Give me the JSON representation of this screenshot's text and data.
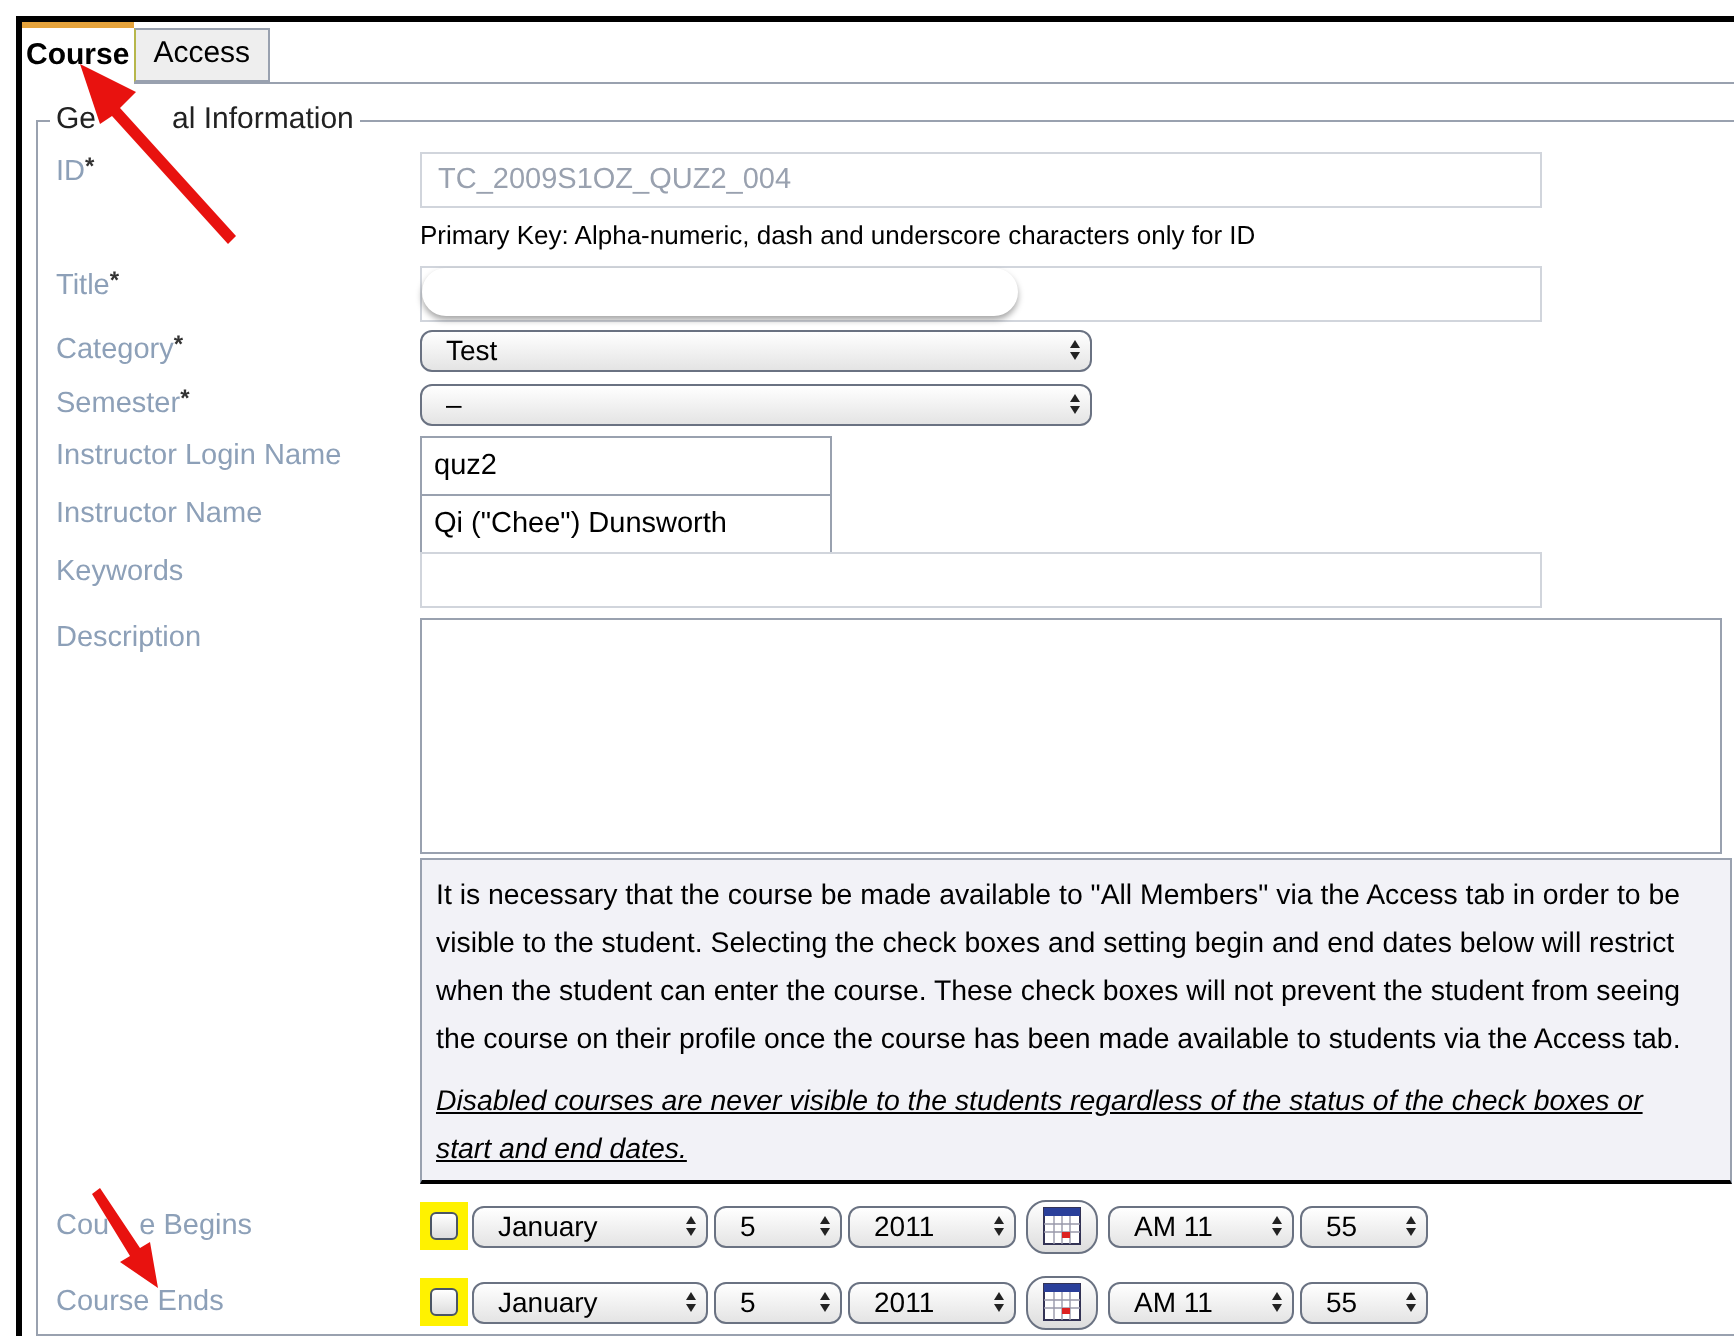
{
  "tabs": [
    {
      "label": "Course",
      "selected": true
    },
    {
      "label": "Access",
      "selected": false
    }
  ],
  "fieldset": {
    "legend_parts": [
      "Ge",
      "al Information"
    ]
  },
  "fields": [
    {
      "kind": "text",
      "label": "ID",
      "marker": "*",
      "value": "TC_2009S1OZ_QUZ2_004",
      "disabled": true,
      "hint": "Primary Key: Alpha-numeric, dash and underscore characters only for ID"
    },
    {
      "kind": "text",
      "label": "Title",
      "marker": "*",
      "redacted": true
    },
    {
      "kind": "select",
      "label": "Category",
      "marker": "*",
      "value": "Test"
    },
    {
      "kind": "select",
      "label": "Semester",
      "marker": "*",
      "value": "–"
    },
    {
      "kind": "short",
      "label": "Instructor Login Name",
      "value": "quz2"
    },
    {
      "kind": "short",
      "label": "Instructor Name",
      "value": "Qi (\"Chee\") Dunsworth"
    },
    {
      "kind": "text",
      "label": "Keywords"
    },
    {
      "kind": "textarea",
      "label": "Description"
    }
  ],
  "note": {
    "text": "It is necessary that the course be made available to \"All Members\" via the Access tab in order to be visible to the student. Selecting the check boxes and setting begin and end dates below will restrict when the student can enter the course. These check boxes will not prevent the student from seeing the course on their profile once the course has been made available to students via the Access tab.",
    "warning": "Disabled courses are never visible to the students regardless of the status of the check boxes or start and end dates."
  },
  "dates": [
    {
      "label_parts": [
        "Cou",
        "e Begins"
      ],
      "checked": false,
      "month": "January",
      "day": "5",
      "year": "2011",
      "hour": "AM 11",
      "minute": "55"
    },
    {
      "label": "Course Ends",
      "checked": false,
      "month": "January",
      "day": "5",
      "year": "2011",
      "hour": "AM 11",
      "minute": "55"
    }
  ]
}
